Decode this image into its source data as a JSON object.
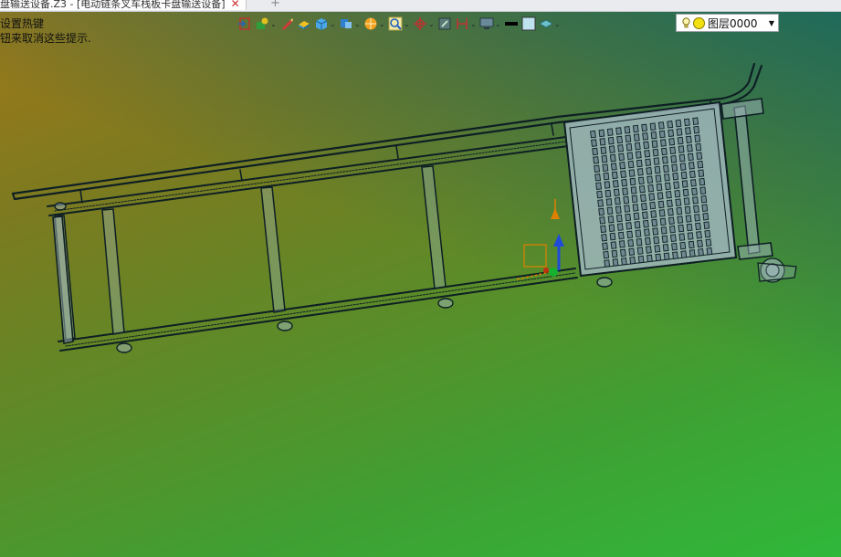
{
  "window": {
    "tab_title": "盘输送设备.Z3 - [电动链条叉车栈板卡盘输送设备]",
    "tab_close": "✕",
    "new_tab": "+"
  },
  "hints": {
    "line1": "设置热键",
    "line2": "钮来取消这些提示."
  },
  "toolbar": {
    "items": [
      {
        "icon": "exit-assembly-icon",
        "dropdown": false
      },
      {
        "icon": "component-insert-icon",
        "dropdown": true
      },
      {
        "icon": "pencil-icon",
        "dropdown": false
      },
      {
        "icon": "shaded-solid-icon",
        "dropdown": false
      },
      {
        "icon": "cube-view-icon",
        "dropdown": true
      },
      {
        "icon": "display-mode-icon",
        "dropdown": true
      },
      {
        "icon": "render-sphere-icon",
        "dropdown": true
      },
      {
        "icon": "zoom-icon",
        "dropdown": true
      },
      {
        "icon": "pick-filter-icon",
        "dropdown": true
      },
      {
        "icon": "snap-icon",
        "dropdown": false
      },
      {
        "icon": "measure-icon",
        "dropdown": true
      },
      {
        "icon": "monitor-icon",
        "dropdown": true
      },
      {
        "icon": "line-color-icon",
        "dropdown": false
      },
      {
        "icon": "face-color-icon",
        "dropdown": false
      },
      {
        "icon": "layer-state-icon",
        "dropdown": true
      }
    ],
    "dropdown_glyph": "⌄"
  },
  "layer": {
    "label": "图层0000",
    "arrow": "▼",
    "color": "#f2e012"
  },
  "colors": {
    "model_line": "#0e1f24",
    "model_fill": "#9fb6bc",
    "axis_x": "#e08000",
    "axis_y": "#1f4bd9",
    "axis_z": "#18b030"
  }
}
